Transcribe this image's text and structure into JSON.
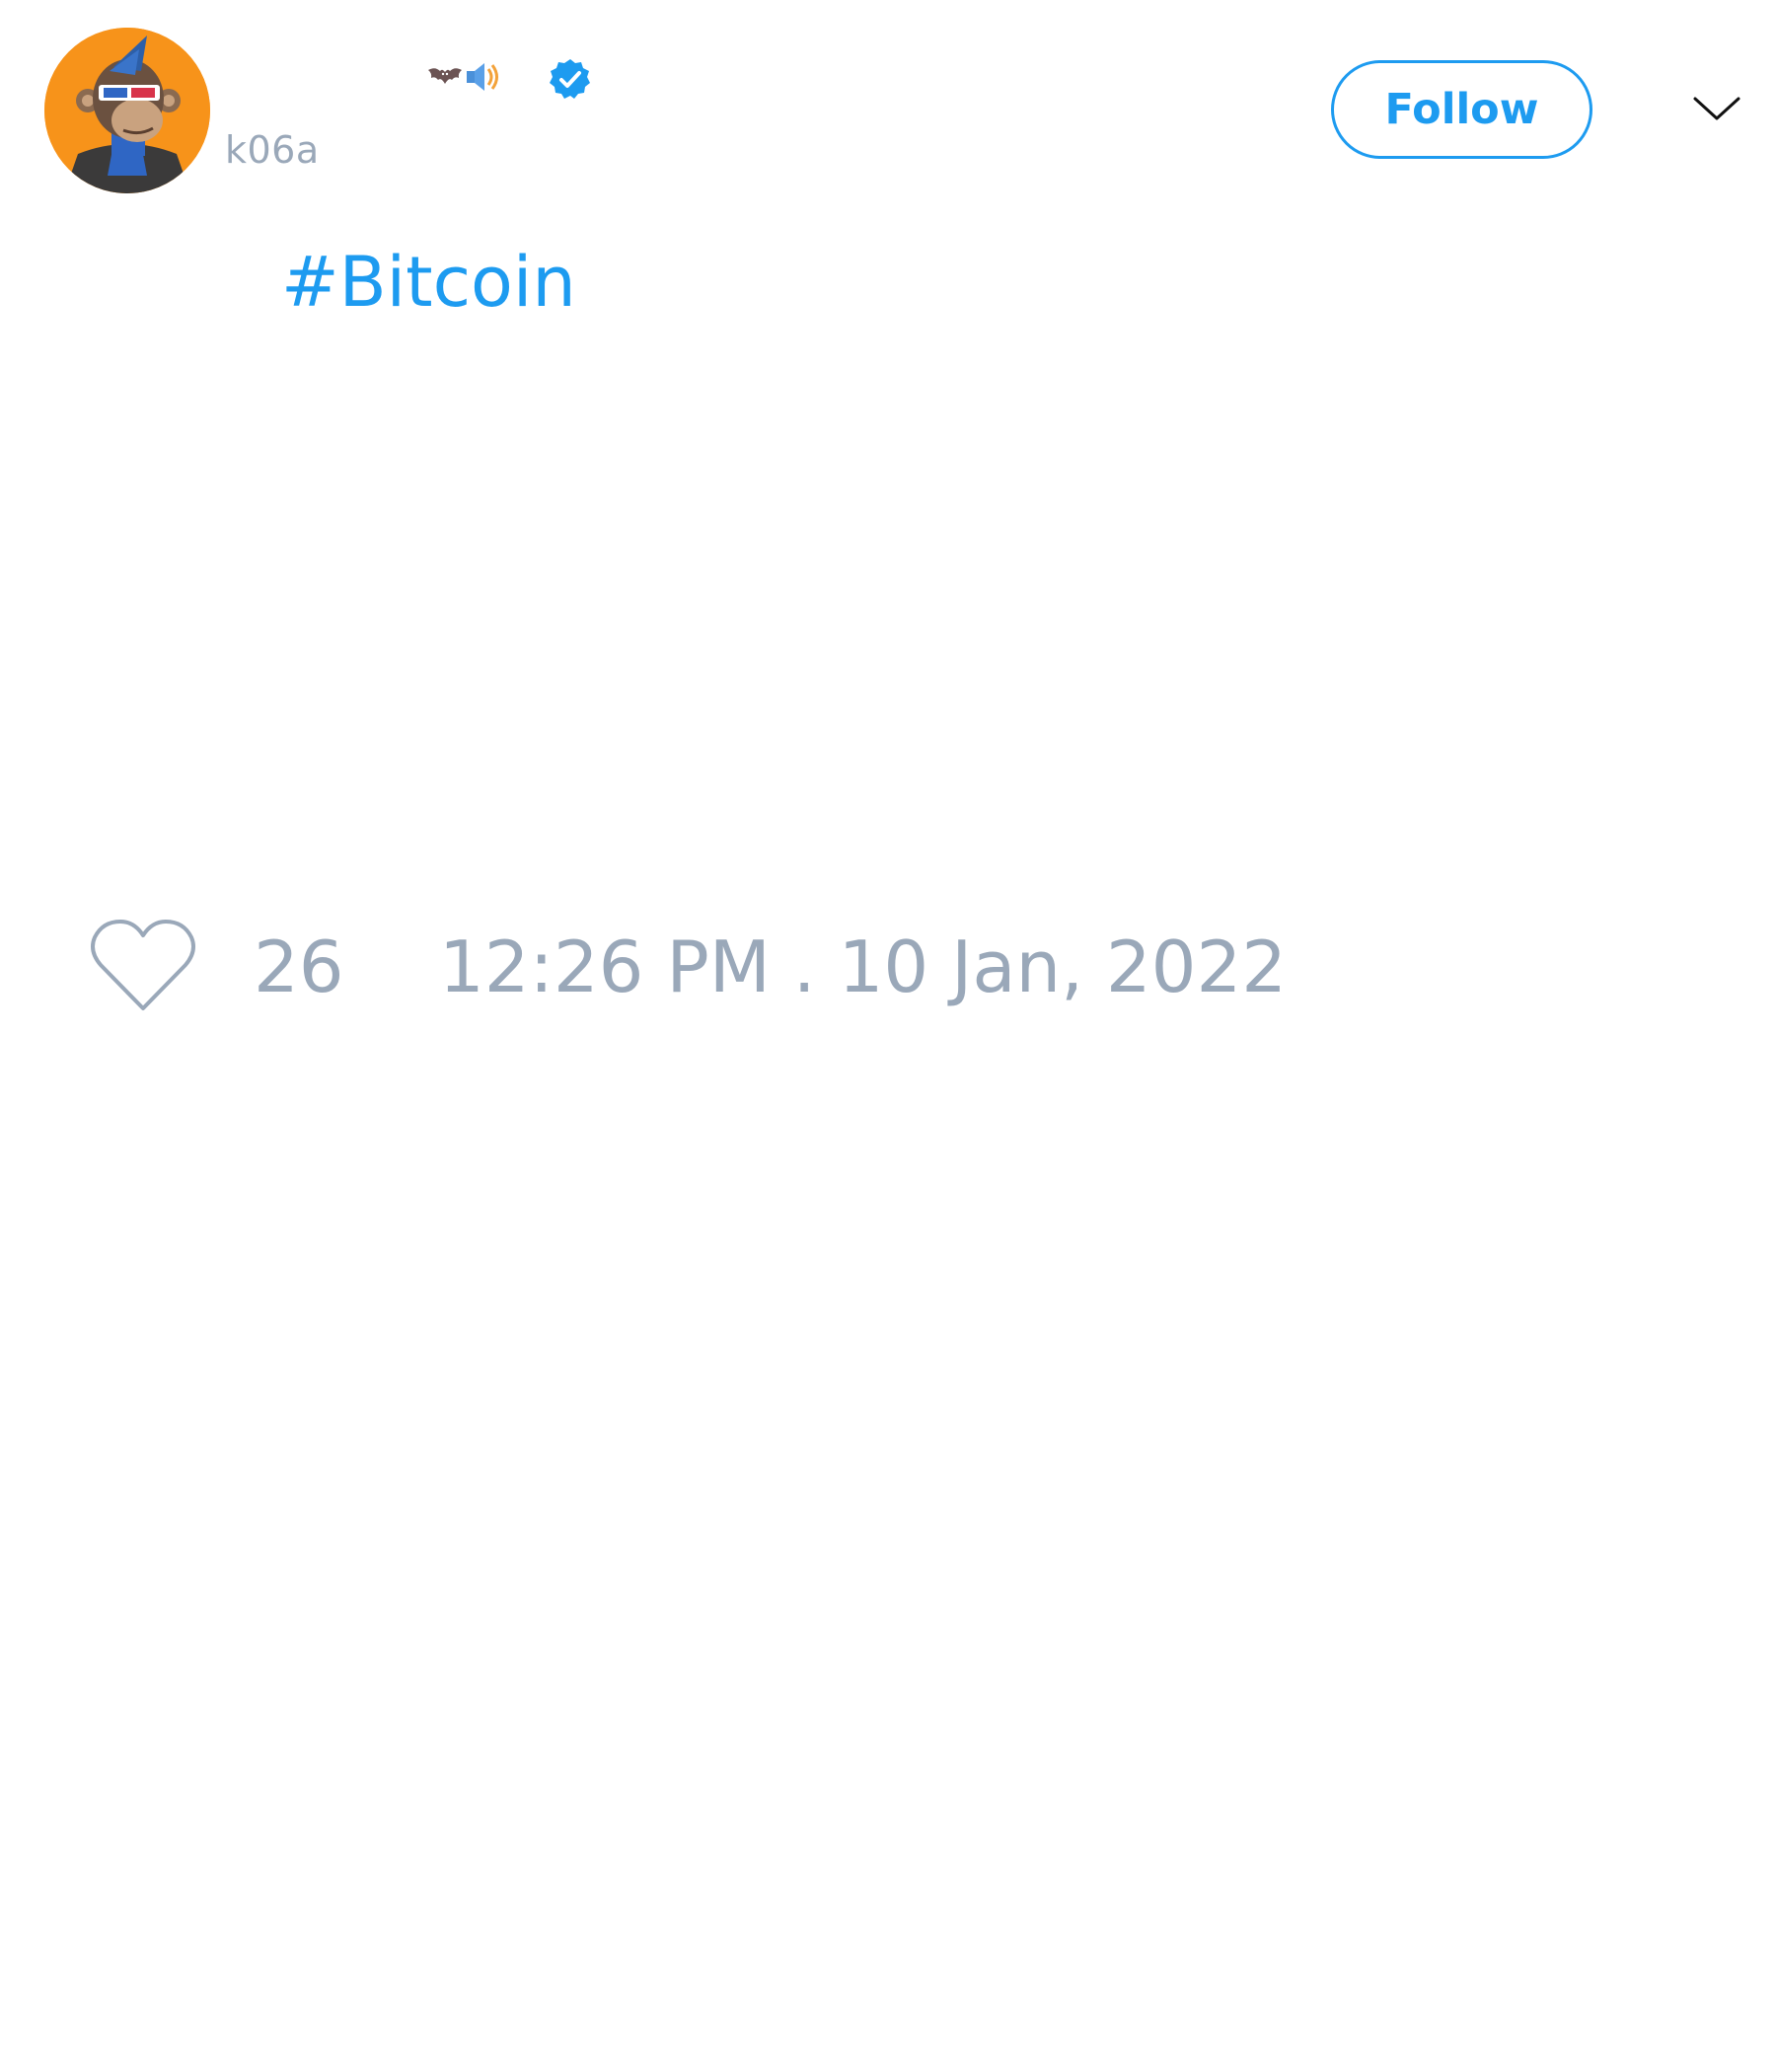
{
  "tweet": {
    "author": {
      "display_name_emoji": [
        "bat-emoji",
        "speaker-emoji"
      ],
      "verified": true,
      "handle": "k06a",
      "avatar_bg": "#f7931a"
    },
    "follow_label": "Follow",
    "text": "#Bitcoin",
    "like_count": "26",
    "timestamp": "12:26 PM . 10 Jan, 2022"
  },
  "colors": {
    "accent": "#1d9bf0",
    "muted": "#9aa8b9",
    "background": "#ffffff"
  }
}
